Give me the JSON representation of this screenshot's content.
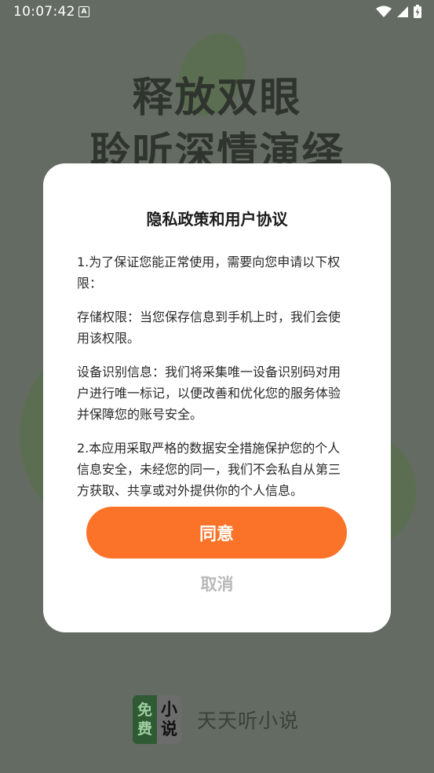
{
  "status_bar": {
    "time": "10:07:42",
    "notification_glyph": "A",
    "icons": [
      "wifi-icon",
      "signal-icon",
      "battery-charging-icon"
    ]
  },
  "background": {
    "headline_line1": "释放双眼",
    "headline_line2": "聆听深情演绎"
  },
  "dialog": {
    "title": "隐私政策和用户协议",
    "paragraphs": [
      "1.为了保证您能正常使用，需要向您申请以下权限：",
      "存储权限：当您保存信息到手机上时，我们会使用该权限。",
      "设备识别信息：我们将采集唯一设备识别码对用户进行唯一标记，以便改善和优化您的服务体验并保障您的账号安全。",
      "2.本应用采取严格的数据安全措施保护您的个人信息安全，未经您的同一，我们不会私自从第三方获取、共享或对外提供你的个人信息。"
    ],
    "agree_label": "同意",
    "cancel_label": "取消"
  },
  "footer": {
    "logo_left_chars": [
      "免",
      "费"
    ],
    "logo_right_chars": [
      "小",
      "说"
    ],
    "app_name": "天天听小说"
  },
  "colors": {
    "background": "#636b62",
    "accent": "#fa7328",
    "cancel_text": "#b9b9b9"
  }
}
